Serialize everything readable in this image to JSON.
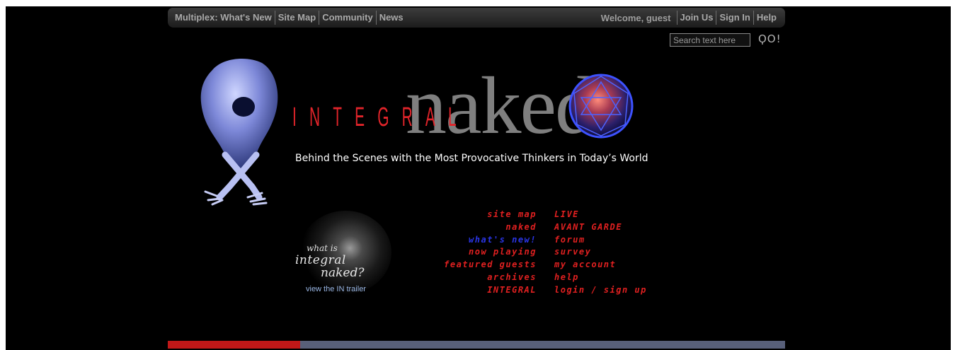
{
  "nav": {
    "left_items": [
      {
        "name": "nav-multiplex-whats-new",
        "label": "Multiplex: What's New"
      },
      {
        "name": "nav-site-map",
        "label": "Site Map"
      },
      {
        "name": "nav-community",
        "label": "Community"
      },
      {
        "name": "nav-news",
        "label": "News"
      }
    ],
    "welcome_text": "Welcome, guest",
    "right_items": [
      {
        "name": "nav-join-us",
        "label": "Join Us"
      },
      {
        "name": "nav-sign-in",
        "label": "Sign In"
      },
      {
        "name": "nav-help",
        "label": "Help"
      }
    ]
  },
  "search": {
    "placeholder": "Search text here",
    "go_label": "ϘO!"
  },
  "logo": {
    "integral": "INTEGRAL",
    "naked": "naked"
  },
  "tagline": "Behind the Scenes with the Most Provocative Thinkers in Today’s World",
  "trailer": {
    "line1": "what is",
    "line2": "integral",
    "line3": "naked?",
    "link": "view the IN trailer"
  },
  "menu_left": [
    {
      "name": "menu-site-map",
      "label": "site map",
      "color": "#e02020"
    },
    {
      "name": "menu-naked",
      "label": "naked",
      "color": "#e02020"
    },
    {
      "name": "menu-whats-new",
      "label": "what's new!",
      "color": "#2a35e6"
    },
    {
      "name": "menu-now-playing",
      "label": "now playing",
      "color": "#e02020"
    },
    {
      "name": "menu-featured-guests",
      "label": "featured guests",
      "color": "#e02020"
    },
    {
      "name": "menu-archives",
      "label": "archives",
      "color": "#e02020"
    },
    {
      "name": "menu-integral",
      "label": "INTEGRAL",
      "color": "#e02020"
    }
  ],
  "menu_right": [
    {
      "name": "menu-live",
      "label": "LIVE"
    },
    {
      "name": "menu-avant-garde",
      "label": "AVANT GARDE"
    },
    {
      "name": "menu-forum",
      "label": "forum"
    },
    {
      "name": "menu-survey",
      "label": "survey"
    },
    {
      "name": "menu-my-account",
      "label": "my account"
    },
    {
      "name": "menu-help",
      "label": "help"
    },
    {
      "name": "menu-login-sign-up",
      "label": "login / sign up"
    }
  ],
  "progress": {
    "fraction": 0.215
  },
  "colors": {
    "accent_red": "#e02020",
    "link_blue": "#2a35e6",
    "background": "#000000",
    "bar_gray": "#58607a"
  }
}
